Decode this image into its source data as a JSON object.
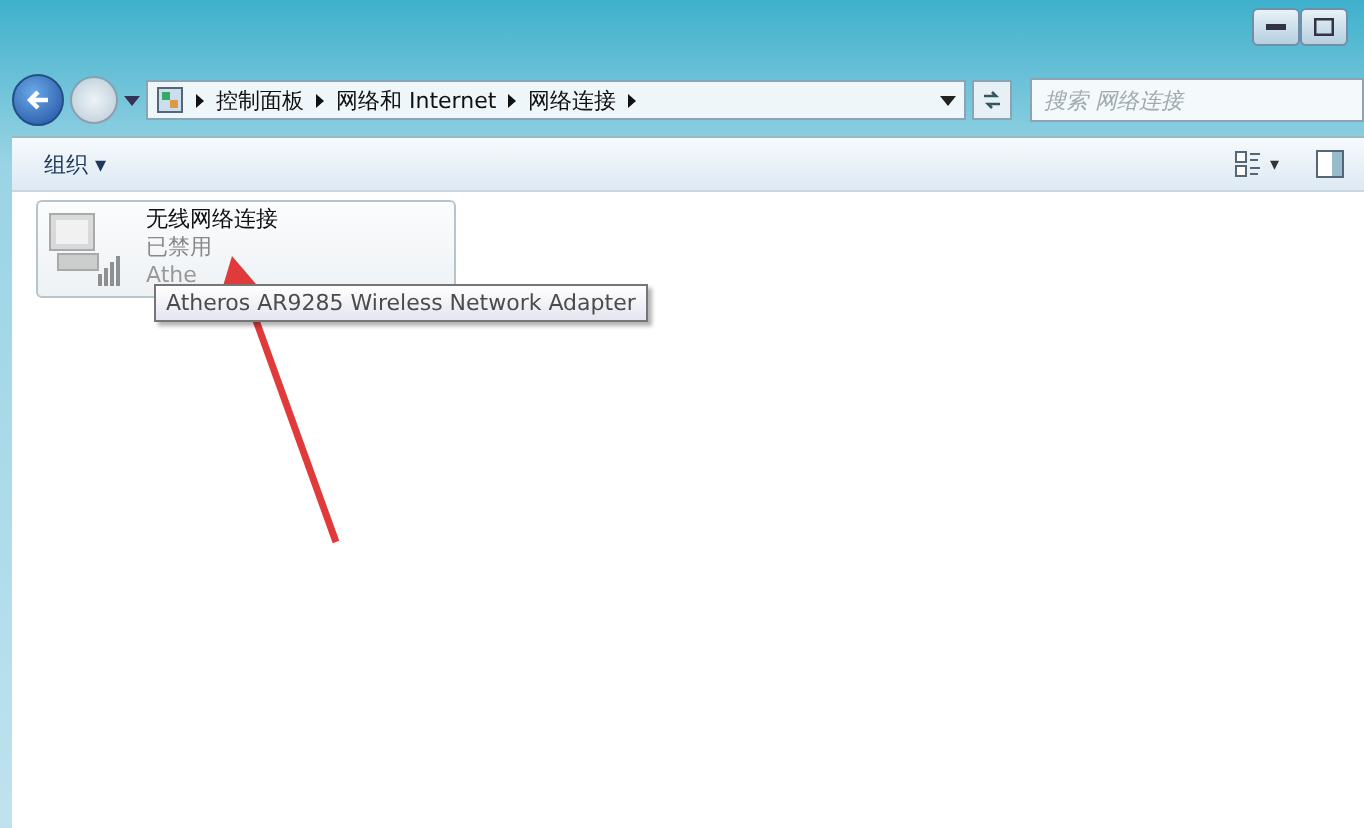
{
  "address_bar": {
    "crumbs": [
      "控制面板",
      "网络和 Internet",
      "网络连接"
    ]
  },
  "search": {
    "placeholder": "搜索 网络连接"
  },
  "toolbar": {
    "organize": "组织 ▾",
    "view_caret": "▾"
  },
  "connections": [
    {
      "name": "无线网络连接",
      "status": "已禁用",
      "adapter": "Athe",
      "disabled": true
    }
  ],
  "tooltip": {
    "text": "Atheros AR9285 Wireless Network Adapter"
  }
}
